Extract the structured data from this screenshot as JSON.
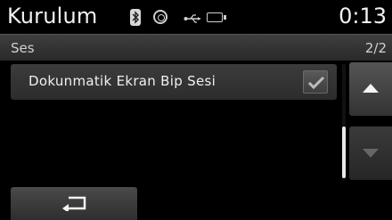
{
  "statusbar": {
    "title": "Kurulum",
    "clock": "0:13",
    "icons": [
      "bluetooth-icon",
      "disc-icon",
      "usb-icon",
      "battery-icon"
    ]
  },
  "subheader": {
    "title": "Ses",
    "page_indicator": "2/2"
  },
  "list": {
    "items": [
      {
        "label": "Dokunmatik Ekran Bip Sesi",
        "checked": true
      }
    ]
  },
  "controls": {
    "up_icon": "arrow-up-icon",
    "down_icon": "arrow-down-icon",
    "back_icon": "back-arrow-icon"
  },
  "colors": {
    "background": "#000000",
    "row": "#333333",
    "text": "#f0f0f0"
  }
}
